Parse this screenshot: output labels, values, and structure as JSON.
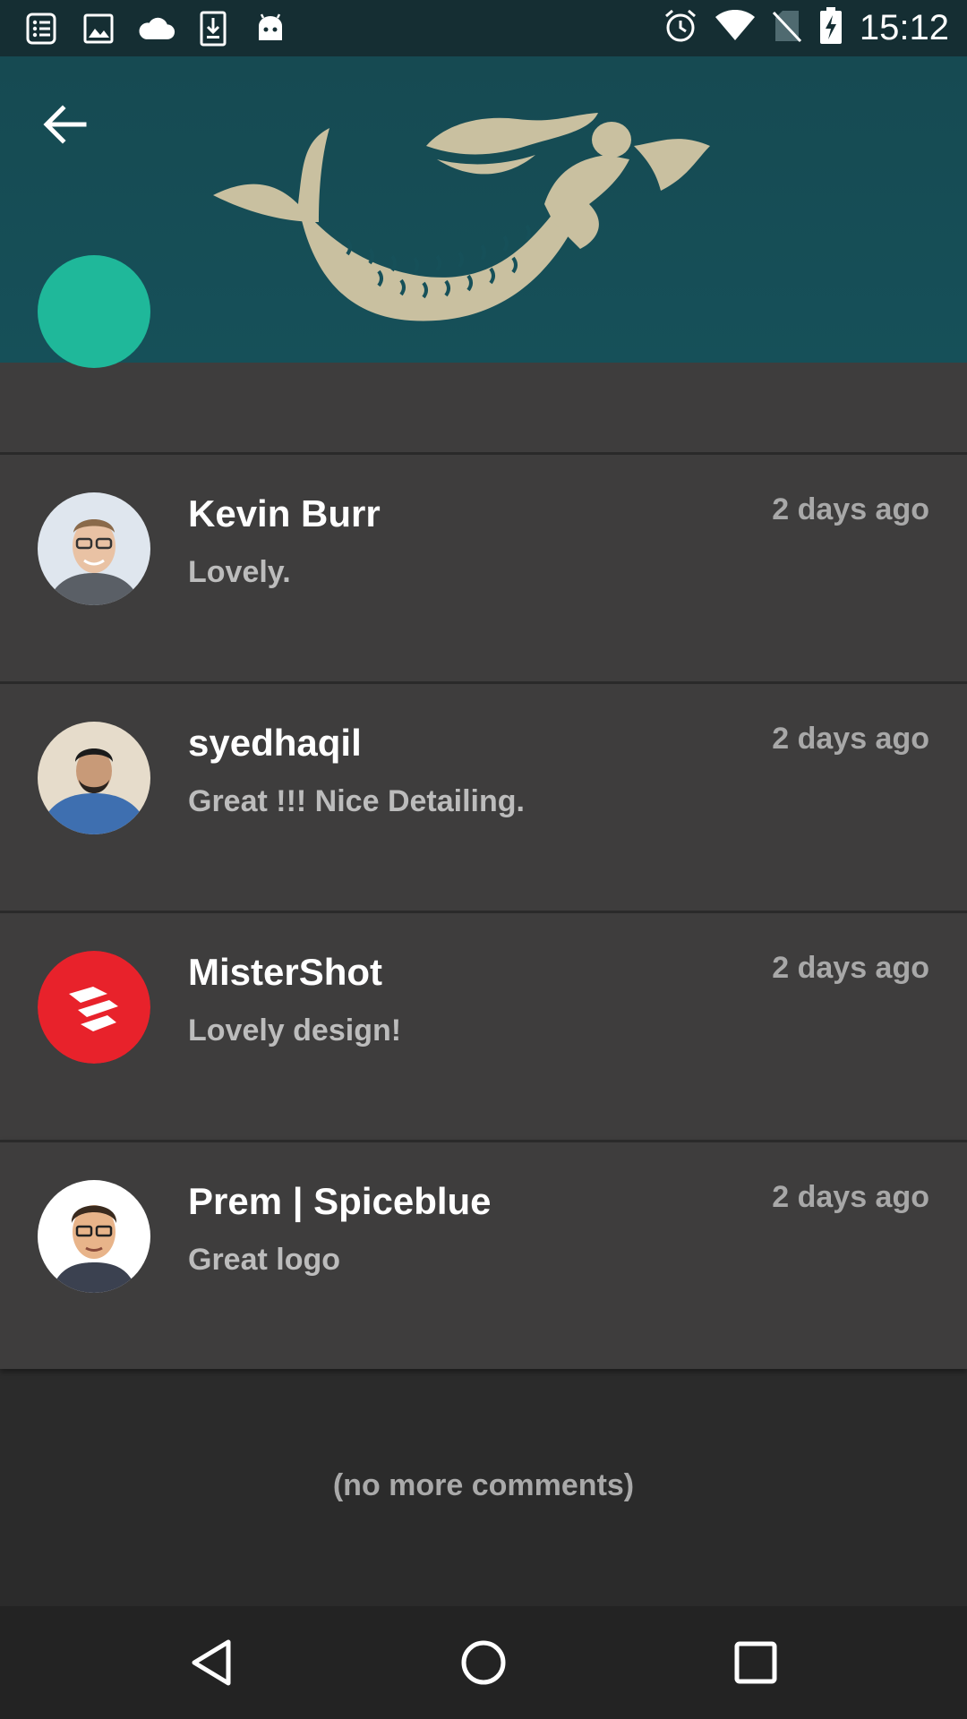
{
  "status_bar": {
    "time": "15:12",
    "left_icons": [
      "list-icon",
      "image-icon",
      "cloud-icon",
      "download-icon",
      "android-icon"
    ],
    "right_icons": [
      "alarm-icon",
      "wifi-icon",
      "no-sim-icon",
      "battery-charging-icon"
    ]
  },
  "header": {
    "back_icon": "arrow-left-icon",
    "logo": "mermaid-logo"
  },
  "comments": [
    {
      "name": "Kevin Burr",
      "time": "2 days ago",
      "text": "Lovely.",
      "avatar": "photo"
    },
    {
      "name": "syedhaqil",
      "time": "2 days ago",
      "text": "Great !!! Nice Detailing.",
      "avatar": "photo"
    },
    {
      "name": "MisterShot",
      "time": "2 days ago",
      "text": "Lovely design!",
      "avatar": "mistershot-logo",
      "avatar_color": "#e8222b"
    },
    {
      "name": "Prem | Spiceblue",
      "time": "2 days ago",
      "text": "Great logo",
      "avatar": "cartoon"
    }
  ],
  "footer_text": "(no more comments)",
  "colors": {
    "header": "#165059",
    "logo": "#c9c0a0",
    "card": "#3e3d3d",
    "background": "#2b2b2b",
    "partial_avatar": "#1fb89a"
  }
}
